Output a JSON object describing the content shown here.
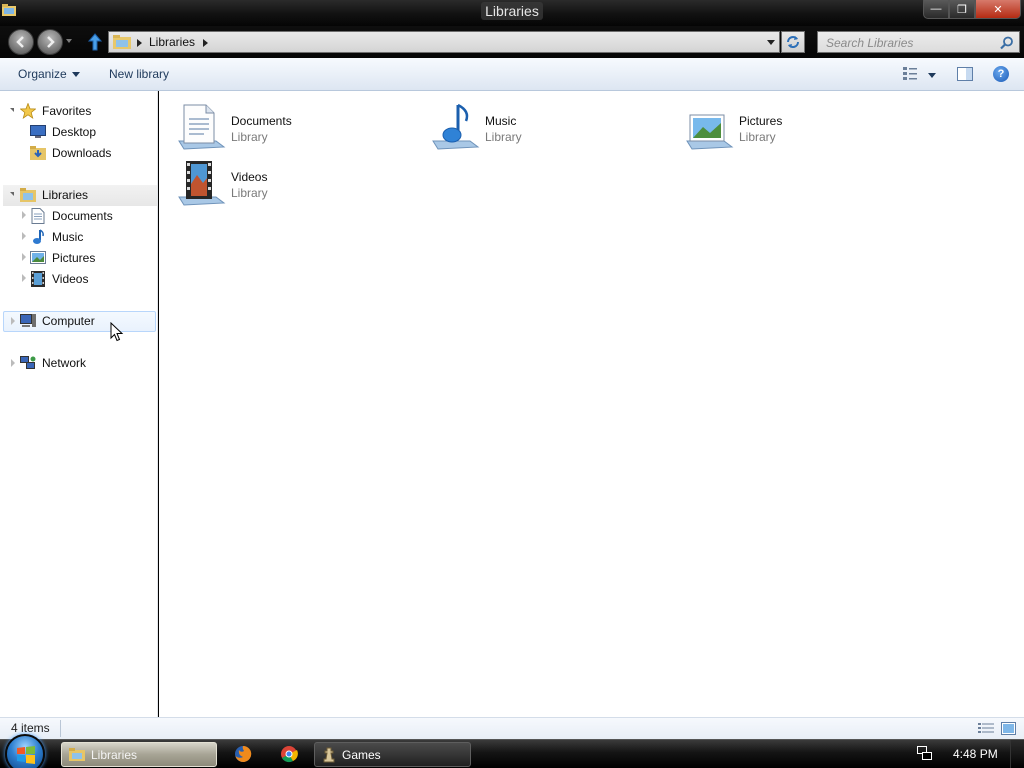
{
  "window": {
    "title": "Libraries",
    "buttons": {
      "minimize": "—",
      "maximize": "❐",
      "close": "✕"
    }
  },
  "address_bar": {
    "crumbs": [
      "Libraries"
    ],
    "search_placeholder": "Search Libraries"
  },
  "command_bar": {
    "organize_label": "Organize",
    "new_library_label": "New library",
    "help_label": "?"
  },
  "nav_pane": {
    "favorites": {
      "label": "Favorites",
      "items": [
        {
          "label": "Desktop",
          "icon": "desktop-icon"
        },
        {
          "label": "Downloads",
          "icon": "downloads-folder-icon"
        }
      ]
    },
    "libraries": {
      "label": "Libraries",
      "items": [
        {
          "label": "Documents",
          "icon": "documents-icon"
        },
        {
          "label": "Music",
          "icon": "music-icon"
        },
        {
          "label": "Pictures",
          "icon": "pictures-icon"
        },
        {
          "label": "Videos",
          "icon": "videos-icon"
        }
      ]
    },
    "computer": {
      "label": "Computer"
    },
    "network": {
      "label": "Network"
    }
  },
  "content": {
    "libraries": [
      {
        "name": "Documents",
        "type": "Library",
        "icon": "documents-library-icon"
      },
      {
        "name": "Music",
        "type": "Library",
        "icon": "music-library-icon"
      },
      {
        "name": "Pictures",
        "type": "Library",
        "icon": "pictures-library-icon"
      },
      {
        "name": "Videos",
        "type": "Library",
        "icon": "videos-library-icon"
      }
    ]
  },
  "status_bar": {
    "item_count": "4 items"
  },
  "taskbar": {
    "tasks": [
      {
        "label": "Libraries",
        "active": true
      },
      {
        "label": "Games",
        "active": false
      }
    ],
    "clock": "4:48 PM"
  },
  "colors": {
    "command_text": "#1e395b",
    "accent_blue": "#2d7fd0",
    "hover_border": "#b8d6fb"
  }
}
